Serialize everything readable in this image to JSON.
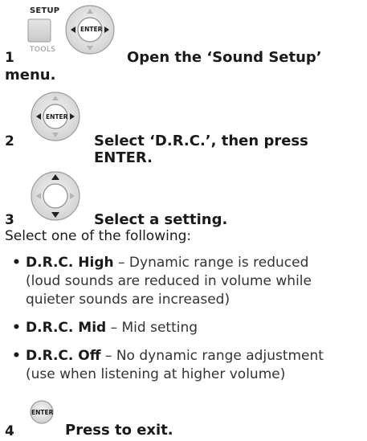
{
  "steps": [
    {
      "number": "1",
      "text_line1": "Open the ‘Sound Setup’",
      "text_line2": "menu.",
      "button_top": "SETUP",
      "button_bottom": "TOOLS",
      "dial_center": "ENTER"
    },
    {
      "number": "2",
      "text": "Select ‘D.R.C.’, then press ENTER.",
      "dial_center": "ENTER"
    },
    {
      "number": "3",
      "text": "Select a setting."
    },
    {
      "number": "4",
      "text": "Press to exit.",
      "button": "ENTER"
    }
  ],
  "intro": "Select one of the following:",
  "options": [
    {
      "term": "D.R.C. High",
      "desc_line1": "– Dynamic range is reduced",
      "desc_line2": "(loud sounds are reduced in volume while",
      "desc_line3": "quieter sounds are increased)"
    },
    {
      "term": "D.R.C. Mid",
      "desc_line1": "– Mid setting"
    },
    {
      "term": "D.R.C. Off",
      "desc_line1": "– No dynamic range adjustment",
      "desc_line2": "(use when listening at higher volume)"
    }
  ],
  "icons": [
    "setup-tools-button-icon",
    "direction-enter-dial-icon",
    "direction-dial-icon",
    "enter-button-icon"
  ]
}
